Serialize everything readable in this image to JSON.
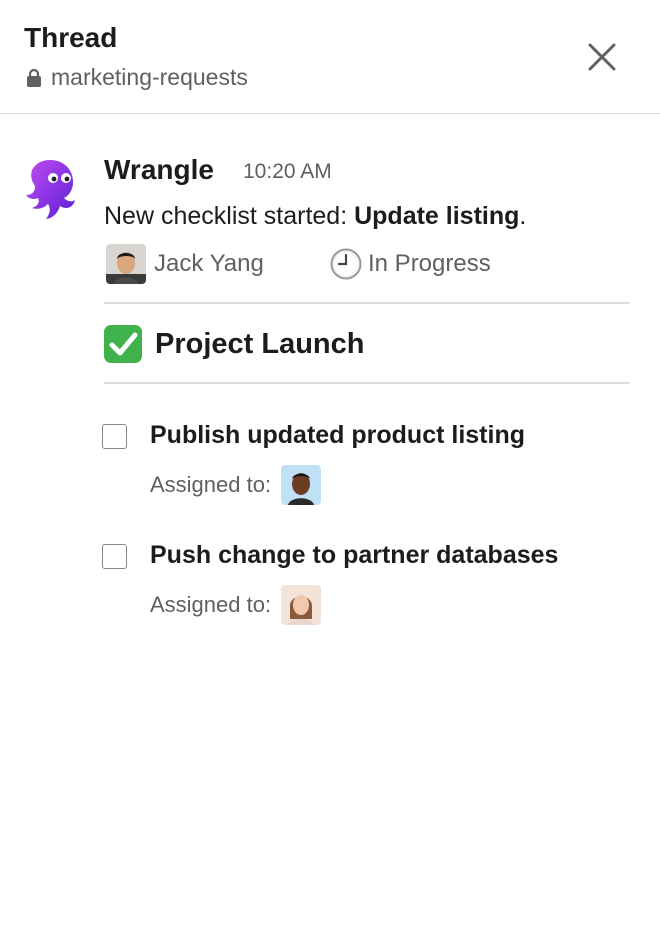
{
  "header": {
    "title": "Thread",
    "channel": "marketing-requests",
    "close_icon": "close-icon"
  },
  "message": {
    "sender": "Wrangle",
    "time": "10:20 AM",
    "text_prefix": "New checklist started: ",
    "text_bold": "Update listing",
    "text_suffix": ".",
    "owner": "Jack Yang",
    "status": "In Progress",
    "status_icon": "clock-icon"
  },
  "checklist": {
    "title": "Project Launch",
    "title_icon": "check-mark-button-icon",
    "items": [
      {
        "label": "Publish updated product listing",
        "assigned_label": "Assigned to:",
        "checked": false
      },
      {
        "label": "Push change to partner databases",
        "assigned_label": "Assigned to:",
        "checked": false
      }
    ]
  },
  "colors": {
    "accent_purple": "#7b2ff7",
    "check_green": "#3fb24c",
    "text_primary": "#1d1c1d",
    "text_secondary": "#616061",
    "divider": "#dddddd"
  }
}
